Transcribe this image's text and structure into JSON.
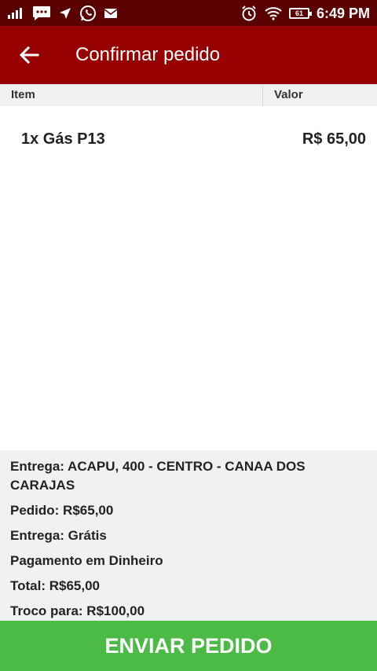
{
  "status_bar": {
    "time": "6:49 PM",
    "battery_level": "61",
    "left_icons": [
      "signal-icon",
      "message-icon",
      "send-icon",
      "whatsapp-icon",
      "mail-icon"
    ],
    "right_icons": [
      "alarm-icon",
      "wifi-icon",
      "battery-icon"
    ]
  },
  "app_bar": {
    "title": "Confirmar pedido",
    "back_icon": "arrow-back-icon",
    "color": "#960000"
  },
  "table": {
    "header_item": "Item",
    "header_value": "Valor",
    "rows": [
      {
        "item": "1x Gás P13",
        "value": "R$ 65,00"
      }
    ]
  },
  "summary": {
    "delivery_address": "Entrega: ACAPU, 400 - CENTRO - CANAA DOS CARAJAS",
    "order_total": "Pedido: R$65,00",
    "delivery_fee": "Entrega: Grátis",
    "payment_method": "Pagamento em Dinheiro",
    "total": "Total: R$65,00",
    "change_for": "Troco para: R$100,00"
  },
  "submit_button": {
    "label": "ENVIAR PEDIDO",
    "color": "#4cbb45"
  }
}
